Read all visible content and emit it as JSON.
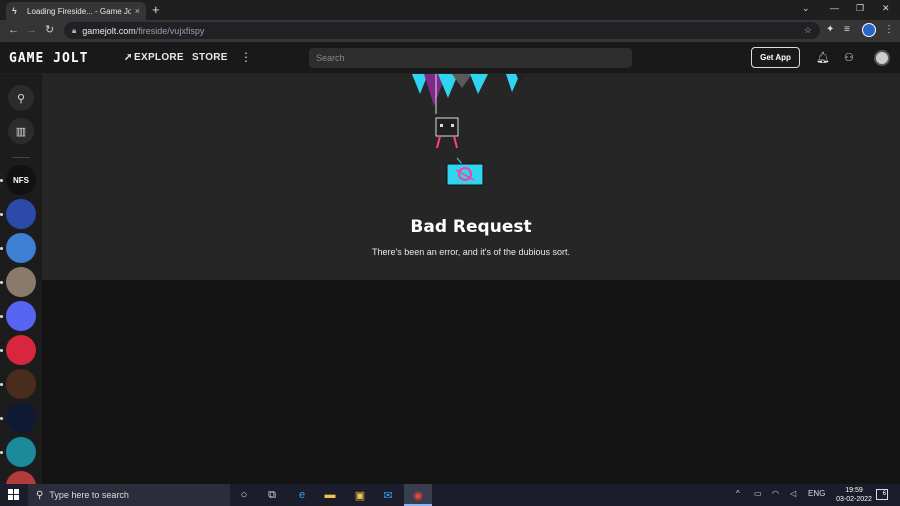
{
  "browser": {
    "tab_title": "Loading Fireside... - Game Jolt",
    "tab_close": "×",
    "new_tab": "+",
    "url_host": "gamejolt.com",
    "url_path": "/fireside/vujxfispy",
    "win_minimize": "—",
    "win_restore": "❐",
    "win_close": "✕",
    "collapse": "⌄"
  },
  "header": {
    "logo": "GAME JOLT",
    "nav_explore": "EXPLORE",
    "nav_store": "STORE",
    "search_placeholder": "Search",
    "get_app": "Get App"
  },
  "error": {
    "title": "Bad Request",
    "message": "There's been an error, and it's of the dubious sort."
  },
  "sidebar": {
    "communities": [
      {
        "label": "NFS",
        "color": "#111111"
      },
      {
        "label": "",
        "color": "#2b4aa8"
      },
      {
        "label": "",
        "color": "#3d7fd0"
      },
      {
        "label": "",
        "color": "#8a7a6a"
      },
      {
        "label": "",
        "color": "#5865f2"
      },
      {
        "label": "",
        "color": "#d7263d"
      },
      {
        "label": "",
        "color": "#4a2c1e"
      },
      {
        "label": "",
        "color": "#0e1a33"
      },
      {
        "label": "",
        "color": "#1b8a9a"
      },
      {
        "label": "",
        "color": "#b33b3b"
      }
    ]
  },
  "taskbar": {
    "search_placeholder": "Type here to search",
    "lang": "ENG",
    "time": "19:59",
    "date": "03-02-2022",
    "notifications": "6"
  },
  "colors": {
    "banner_bg": "#262626",
    "page_bg": "#121212",
    "accent_cyan": "#2fd4f0",
    "accent_pink": "#ff3d9a"
  }
}
